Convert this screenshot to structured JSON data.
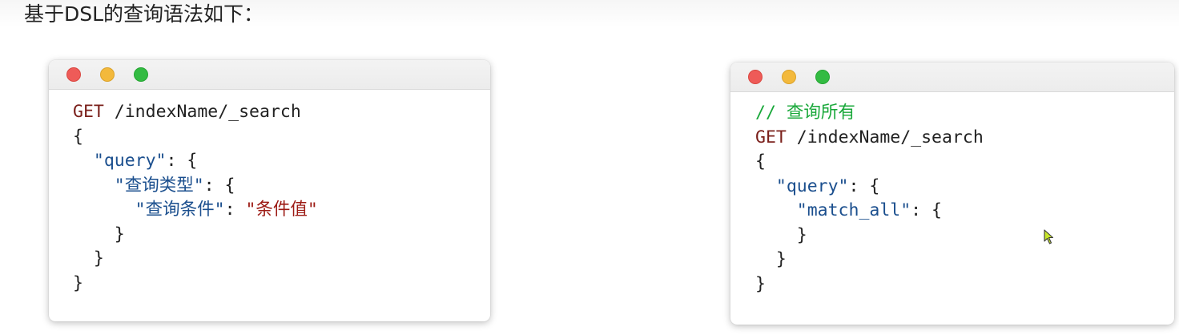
{
  "heading": "基于DSL的查询语法如下：",
  "left_window": {
    "lines": [
      {
        "indent": "",
        "method": "GET",
        "path": " /indexName/_search"
      },
      {
        "indent": "",
        "text": "{"
      },
      {
        "indent": "  ",
        "key": "\"query\"",
        "rest": ": {"
      },
      {
        "indent": "    ",
        "key": "\"查询类型\"",
        "rest": ": {"
      },
      {
        "indent": "      ",
        "key": "\"查询条件\"",
        "rest": ": ",
        "value": "\"条件值\""
      },
      {
        "indent": "    ",
        "text": "}"
      },
      {
        "indent": "  ",
        "text": "}"
      },
      {
        "indent": "",
        "text": "}"
      }
    ]
  },
  "right_window": {
    "lines": [
      {
        "indent": "",
        "comment": "// 查询所有"
      },
      {
        "indent": "",
        "method": "GET",
        "path": " /indexName/_search"
      },
      {
        "indent": "",
        "text": "{"
      },
      {
        "indent": "  ",
        "key": "\"query\"",
        "rest": ": {"
      },
      {
        "indent": "    ",
        "key": "\"match_all\"",
        "rest": ": {"
      },
      {
        "indent": "    ",
        "text": "}"
      },
      {
        "indent": "  ",
        "text": "}"
      },
      {
        "indent": "",
        "text": "}"
      }
    ]
  },
  "colors": {
    "method": "#7a1f1a",
    "key": "#1b4f8e",
    "string": "#9c1a14",
    "comment": "#19a83a",
    "close_dot": "#ee5b58",
    "minimize_dot": "#f3b93c",
    "maximize_dot": "#33bb42"
  }
}
